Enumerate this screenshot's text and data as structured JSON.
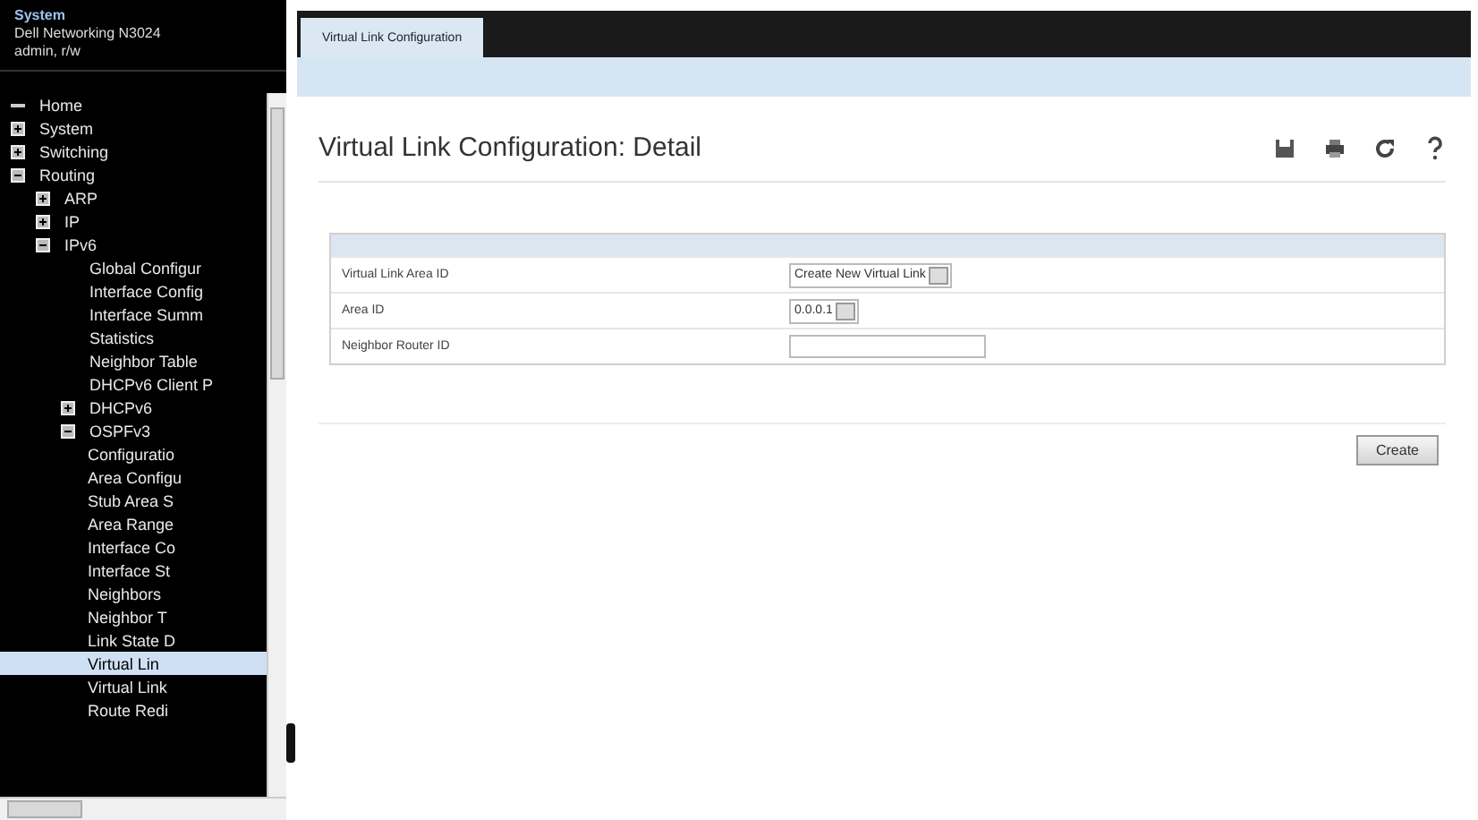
{
  "header": {
    "title": "System",
    "device": "Dell Networking N3024",
    "user": "admin, r/w"
  },
  "tree": [
    {
      "label": "Home"
    },
    {
      "label": "System",
      "expanded": false
    },
    {
      "label": "Switching",
      "expanded": false
    },
    {
      "label": "Routing",
      "expanded": true,
      "children": [
        {
          "label": "ARP",
          "expanded": false
        },
        {
          "label": "IP",
          "expanded": false
        },
        {
          "label": "IPv6",
          "expanded": true,
          "children": [
            {
              "label": "Global Configur",
              "selected": false
            },
            {
              "label": "Interface Config",
              "selected": false
            },
            {
              "label": "Interface Summ",
              "selected": false
            },
            {
              "label": "Statistics",
              "selected": false
            },
            {
              "label": "Neighbor Table",
              "selected": false
            },
            {
              "label": "DHCPv6 Client P",
              "selected": false
            },
            {
              "label": "DHCPv6",
              "expanded": false
            },
            {
              "label": "OSPFv3",
              "expanded": true,
              "children": [
                {
                  "label": "Configuratio",
                  "selected": false
                },
                {
                  "label": "Area Configu",
                  "selected": false
                },
                {
                  "label": "Stub Area S",
                  "selected": false
                },
                {
                  "label": "Area Range",
                  "selected": false
                },
                {
                  "label": "Interface Co",
                  "selected": false
                },
                {
                  "label": "Interface St",
                  "selected": false
                },
                {
                  "label": "Neighbors",
                  "selected": false
                },
                {
                  "label": "Neighbor T",
                  "selected": false
                },
                {
                  "label": "Link State D",
                  "selected": false
                },
                {
                  "label": "Virtual Lin",
                  "selected": true
                },
                {
                  "label": "Virtual Link",
                  "selected": false
                },
                {
                  "label": "Route Redi",
                  "selected": false
                }
              ]
            }
          ]
        }
      ]
    }
  ],
  "tabs": [
    {
      "label": "Virtual Link Configuration",
      "selected": true
    }
  ],
  "page_title": "Virtual Link Configuration: Detail",
  "form": [
    {
      "kind": "select",
      "label": "Virtual Link Area ID",
      "value": "Create New Virtual Link"
    },
    {
      "kind": "select",
      "label": "Area ID",
      "value": "0.0.0.1"
    },
    {
      "kind": "input",
      "label": "Neighbor Router ID"
    }
  ],
  "buttons": [
    {
      "label": "Create"
    }
  ]
}
